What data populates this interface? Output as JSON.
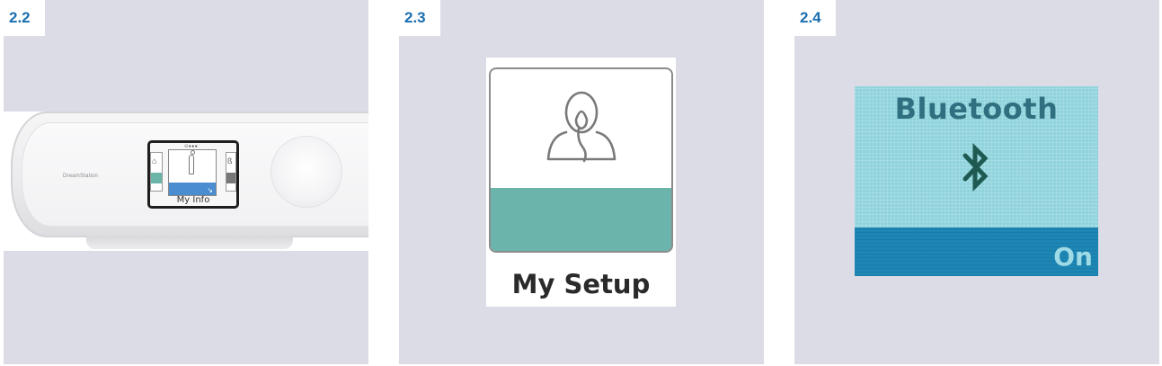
{
  "panels": [
    {
      "tag": "2.2",
      "device": {
        "brand": "DreamStation",
        "status_dots": "⊙●●●",
        "screen_label": "My Info"
      }
    },
    {
      "tag": "2.3",
      "icon": "user-mask-icon",
      "label": "My Setup",
      "accent": "#6ab4ac"
    },
    {
      "tag": "2.4",
      "title": "Bluetooth",
      "icon": "bluetooth-icon",
      "state": "On",
      "colors": {
        "screen": "#8fd3dc",
        "bar": "#1d86b5"
      }
    }
  ]
}
